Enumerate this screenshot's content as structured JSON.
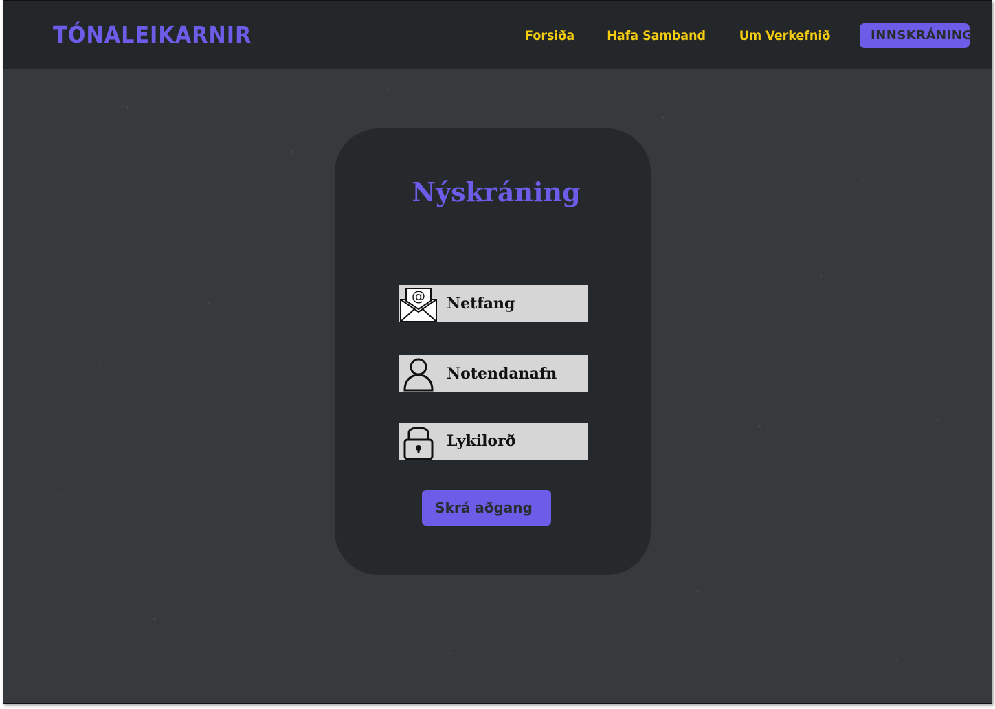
{
  "header": {
    "brand": "TÓNALEIKARNIR",
    "nav": [
      {
        "label": "Forsiða"
      },
      {
        "label": "Hafa Samband"
      },
      {
        "label": "Um Verkefnið"
      }
    ],
    "login_label": "INNSKRÁNING"
  },
  "form": {
    "title": "Nýskráning",
    "fields": [
      {
        "label": "Netfang",
        "icon": "envelope-at-icon"
      },
      {
        "label": "Notendanafn",
        "icon": "user-icon"
      },
      {
        "label": "Lykilorð",
        "icon": "lock-icon"
      }
    ],
    "submit_label": "Skrá aðgang"
  },
  "colors": {
    "accent": "#6c5ce7",
    "nav_link": "#f5cd10",
    "header_bg": "#232729",
    "page_bg": "#363a3d",
    "card_bg": "#25292b",
    "field_bg": "#d6d6d6"
  }
}
